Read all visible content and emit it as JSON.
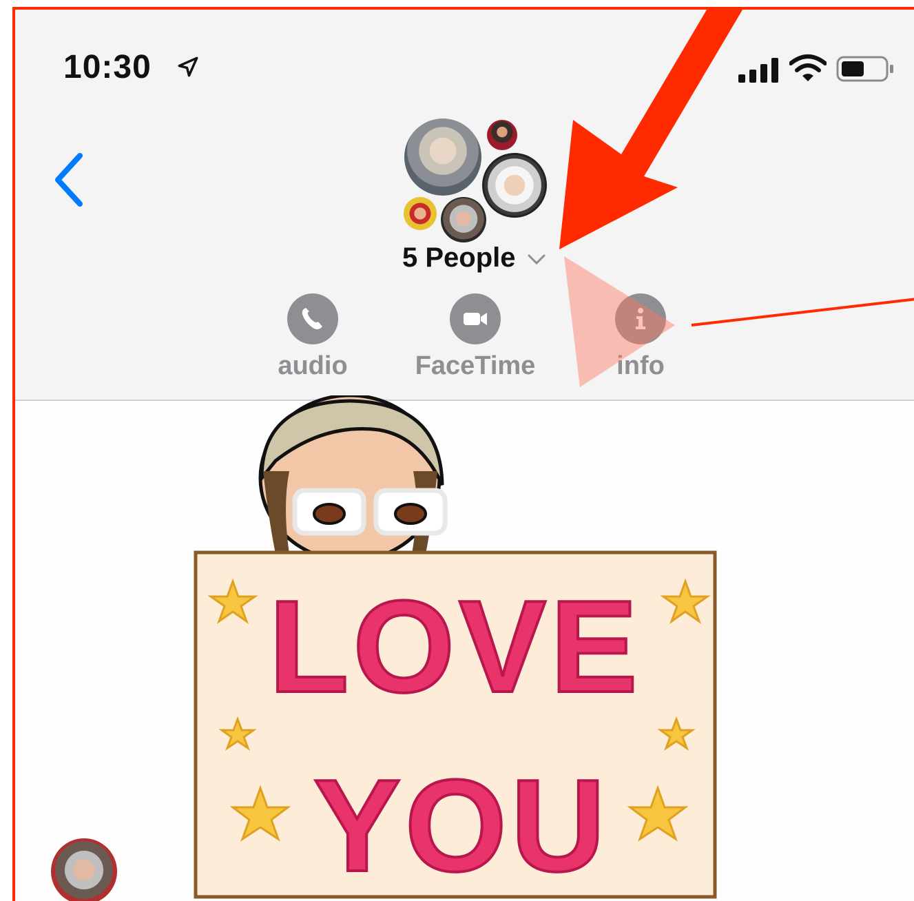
{
  "status_bar": {
    "time": "10:30",
    "icons": [
      "location-arrow-icon",
      "cellular-signal-icon",
      "wifi-icon",
      "battery-icon"
    ]
  },
  "header": {
    "back_icon": "chevron-left-icon",
    "group_name": "5 People",
    "group_chevron": "chevron-down-icon",
    "actions": [
      {
        "label": "audio",
        "icon": "phone-icon"
      },
      {
        "label": "FaceTime",
        "icon": "video-camera-icon"
      },
      {
        "label": "info",
        "icon": "info-icon"
      }
    ]
  },
  "message": {
    "sticker_text": "LOVE YOU"
  },
  "colors": {
    "accent": "#007aff",
    "annotation": "#ff2a00",
    "icon_gray": "#8e8e93"
  }
}
